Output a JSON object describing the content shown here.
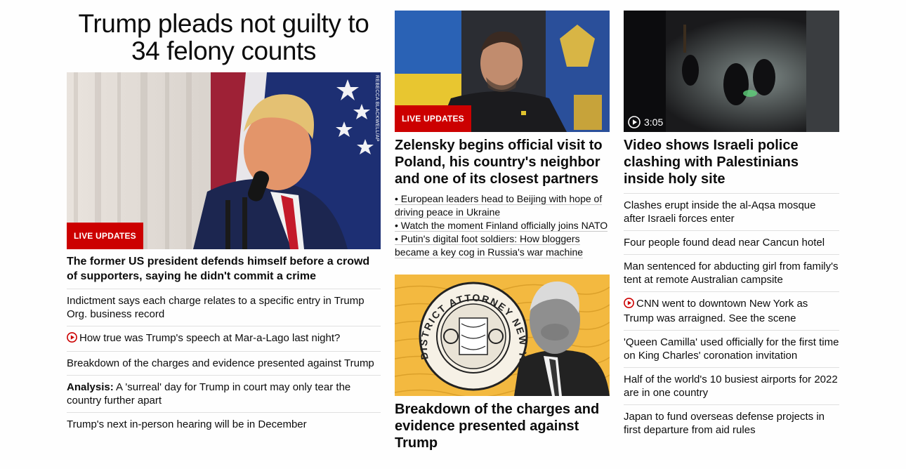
{
  "lead": {
    "headline": "Trump pleads not guilty to 34 felony counts",
    "image_credit": "REBECCA BLACKWELL/AP",
    "badge": "LIVE UPDATES",
    "title": "The former US president defends himself before a crowd of supporters, saying he didn't commit a crime",
    "links": [
      {
        "text": "Indictment says each charge relates to a specific entry in Trump Org. business record"
      },
      {
        "text": "How true was Trump's speech at Mar-a-Lago last night?",
        "icon": "play-icon"
      },
      {
        "text": "Breakdown of the charges and evidence presented against Trump"
      },
      {
        "prefix": "Analysis:",
        "text": " A 'surreal' day for Trump in court may only tear the country further apart"
      },
      {
        "text": "Trump's next in-person hearing will be in December"
      }
    ]
  },
  "zelensky": {
    "badge": "LIVE UPDATES",
    "title": "Zelensky begins official visit to Poland, his country's neighbor and one of its closest partners",
    "bullets": [
      "• European leaders head to Beijing with hope of driving peace in Ukraine",
      "• Watch the moment Finland officially joins NATO",
      "• Putin's digital foot soldiers: How bloggers became a key cog in Russia's war machine"
    ]
  },
  "charges": {
    "seal_text": "DISTRICT ATTORNEY NEW YORK",
    "title": "Breakdown of the charges and evidence presented against Trump"
  },
  "video": {
    "duration": "3:05",
    "title": "Video shows Israeli police clashing with Palestinians inside holy site",
    "links": [
      {
        "text": "Clashes erupt inside the al-Aqsa mosque after Israeli forces enter"
      },
      {
        "text": "Four people found dead near Cancun hotel"
      },
      {
        "text": "Man sentenced for abducting girl from family's tent at remote Australian campsite"
      },
      {
        "text": "CNN went to downtown New York as Trump was arraigned. See the scene",
        "icon": "play-icon"
      },
      {
        "text": "'Queen Camilla' used officially for the first time on King Charles' coronation invitation"
      },
      {
        "text": "Half of the world's 10 busiest airports for 2022 are in one country"
      },
      {
        "text": "Japan to fund overseas defense projects in first departure from aid rules"
      }
    ]
  },
  "colors": {
    "accent": "#cc0000",
    "text": "#0c0c0c",
    "divider": "#e0e0e0"
  }
}
